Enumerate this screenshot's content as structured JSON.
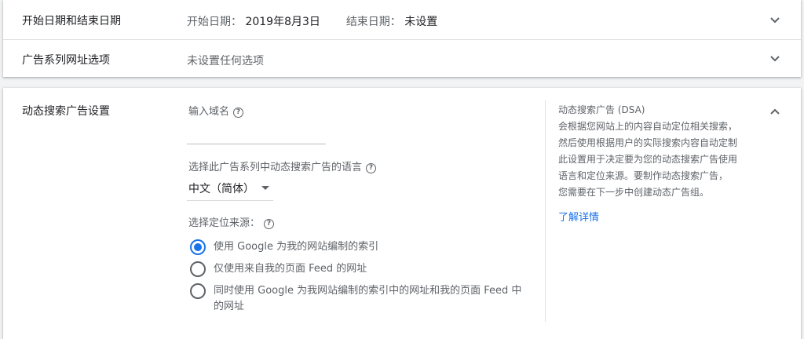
{
  "date_row": {
    "title": "开始日期和结束日期",
    "start_label": "开始日期：",
    "start_value": "2019年8月3日",
    "end_label": "结束日期：",
    "end_value": "未设置"
  },
  "url_row": {
    "title": "广告系列网址选项",
    "value": "未设置任何选项"
  },
  "dsa": {
    "title": "动态搜索广告设置",
    "domain_label": "输入域名",
    "language_label": "选择此广告系列中动态搜索广告的语言",
    "language_value": "中文（简体）",
    "targeting_label": "选择定位来源：",
    "options": [
      {
        "label": "使用 Google 为我的网站编制的索引",
        "checked": true
      },
      {
        "label": "仅使用来自我的页面 Feed 的网址",
        "checked": false
      },
      {
        "label_line1": "同时使用 Google 为我网站编制的索引中的网址和我的页面 Feed 中",
        "label_line2": "的网址",
        "checked": false
      }
    ],
    "side": {
      "title": "动态搜索广告 (DSA)",
      "lines": [
        "会根据您网站上的内容自动定位相关搜索，",
        "然后使用根据用户的实际搜索内容自动定制",
        "此设置用于决定要为您的动态搜索广告使用",
        "语言和定位来源。要制作动态搜索广告，",
        "您需要在下一步中创建动态广告组。"
      ],
      "learn_more": "了解详情"
    }
  },
  "icons": {
    "expand": "chevron-down-icon",
    "collapse": "chevron-up-icon",
    "help": "help-circle-icon",
    "dropdown": "dropdown-arrow-icon"
  },
  "colors": {
    "accent": "#1a73e8",
    "text_primary": "#202124",
    "text_secondary": "#5f6368",
    "background": "#f1f3f4"
  }
}
